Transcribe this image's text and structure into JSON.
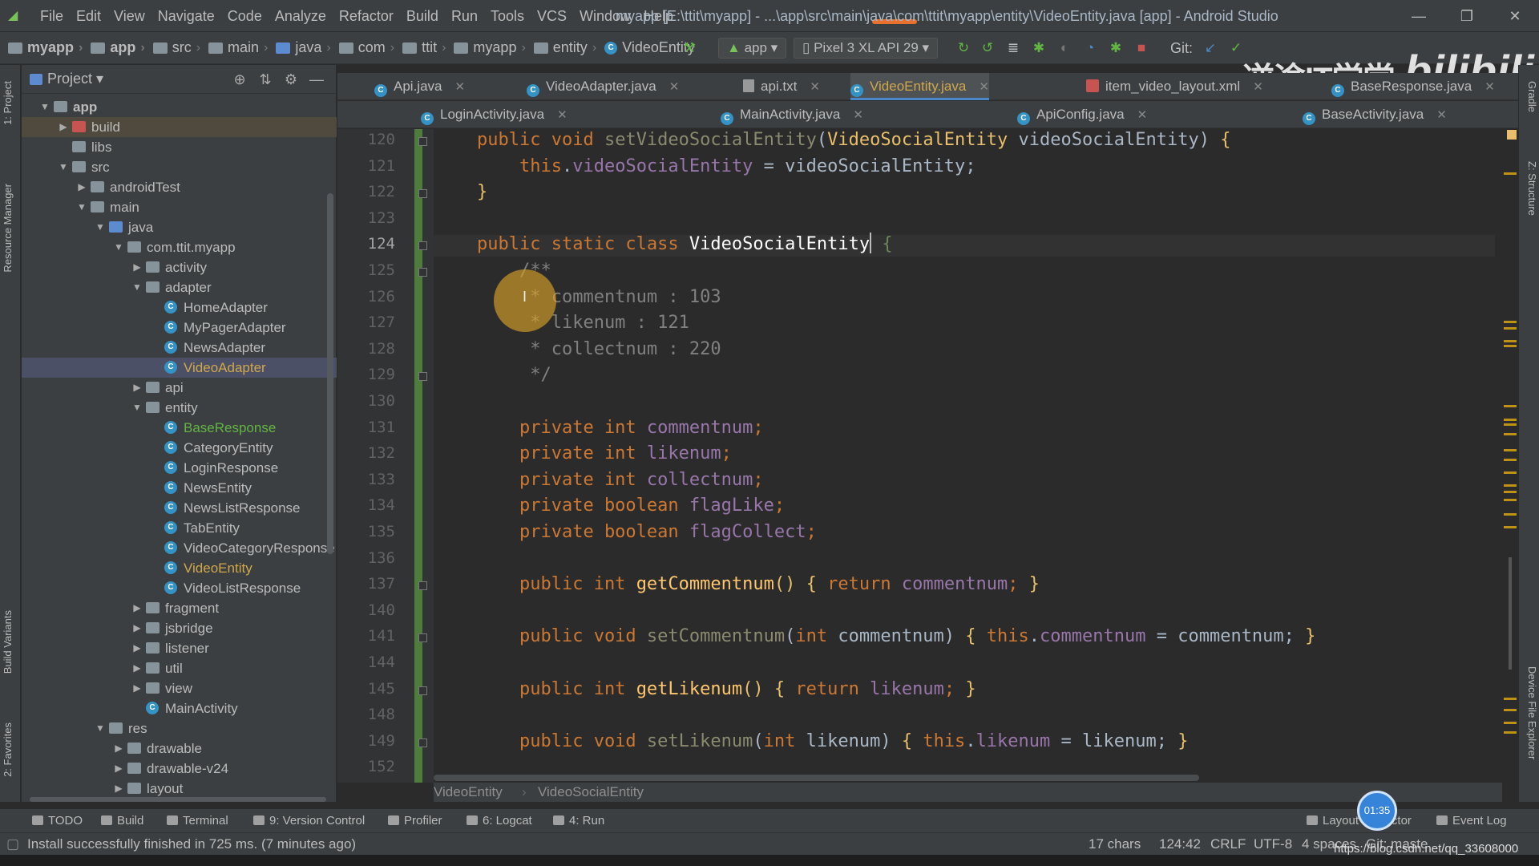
{
  "window": {
    "menu": [
      "File",
      "Edit",
      "View",
      "Navigate",
      "Code",
      "Analyze",
      "Refactor",
      "Build",
      "Run",
      "Tools",
      "VCS",
      "Window",
      "Help"
    ],
    "title": "myapp [E:\\ttit\\myapp] - ...\\app\\src\\main\\java\\com\\ttit\\myapp\\entity\\VideoEntity.java [app] - Android Studio",
    "controls": [
      "—",
      "❐",
      "✕"
    ]
  },
  "nav": {
    "crumbs": [
      "myapp",
      "app",
      "src",
      "main",
      "java",
      "com",
      "ttit",
      "myapp",
      "entity",
      "VideoEntity"
    ],
    "run_config": "app",
    "device": "Pixel 3 XL API 29",
    "git_label": "Git:"
  },
  "project": {
    "title": "Project",
    "tree": [
      {
        "label": "app",
        "depth": 0,
        "arrow": "▼",
        "icon": "folder",
        "style": "bold"
      },
      {
        "label": "build",
        "depth": 1,
        "arrow": "▶",
        "icon": "folder-red",
        "style": "hl"
      },
      {
        "label": "libs",
        "depth": 1,
        "arrow": "",
        "icon": "folder"
      },
      {
        "label": "src",
        "depth": 1,
        "arrow": "▼",
        "icon": "folder"
      },
      {
        "label": "androidTest",
        "depth": 2,
        "arrow": "▶",
        "icon": "folder"
      },
      {
        "label": "main",
        "depth": 2,
        "arrow": "▼",
        "icon": "folder"
      },
      {
        "label": "java",
        "depth": 3,
        "arrow": "▼",
        "icon": "folder-blue"
      },
      {
        "label": "com.ttit.myapp",
        "depth": 4,
        "arrow": "▼",
        "icon": "folder"
      },
      {
        "label": "activity",
        "depth": 5,
        "arrow": "▶",
        "icon": "folder"
      },
      {
        "label": "adapter",
        "depth": 5,
        "arrow": "▼",
        "icon": "folder"
      },
      {
        "label": "HomeAdapter",
        "depth": 6,
        "arrow": "",
        "icon": "class"
      },
      {
        "label": "MyPagerAdapter",
        "depth": 6,
        "arrow": "",
        "icon": "class"
      },
      {
        "label": "NewsAdapter",
        "depth": 6,
        "arrow": "",
        "icon": "class"
      },
      {
        "label": "VideoAdapter",
        "depth": 6,
        "arrow": "",
        "icon": "class",
        "style": "sel-blue"
      },
      {
        "label": "api",
        "depth": 5,
        "arrow": "▶",
        "icon": "folder"
      },
      {
        "label": "entity",
        "depth": 5,
        "arrow": "▼",
        "icon": "folder"
      },
      {
        "label": "BaseResponse",
        "depth": 6,
        "arrow": "",
        "icon": "class",
        "style": "green"
      },
      {
        "label": "CategoryEntity",
        "depth": 6,
        "arrow": "",
        "icon": "class"
      },
      {
        "label": "LoginResponse",
        "depth": 6,
        "arrow": "",
        "icon": "class"
      },
      {
        "label": "NewsEntity",
        "depth": 6,
        "arrow": "",
        "icon": "class"
      },
      {
        "label": "NewsListResponse",
        "depth": 6,
        "arrow": "",
        "icon": "class"
      },
      {
        "label": "TabEntity",
        "depth": 6,
        "arrow": "",
        "icon": "class"
      },
      {
        "label": "VideoCategoryResponse",
        "depth": 6,
        "arrow": "",
        "icon": "class"
      },
      {
        "label": "VideoEntity",
        "depth": 6,
        "arrow": "",
        "icon": "class",
        "style": "blue"
      },
      {
        "label": "VideoListResponse",
        "depth": 6,
        "arrow": "",
        "icon": "class"
      },
      {
        "label": "fragment",
        "depth": 5,
        "arrow": "▶",
        "icon": "folder"
      },
      {
        "label": "jsbridge",
        "depth": 5,
        "arrow": "▶",
        "icon": "folder"
      },
      {
        "label": "listener",
        "depth": 5,
        "arrow": "▶",
        "icon": "folder"
      },
      {
        "label": "util",
        "depth": 5,
        "arrow": "▶",
        "icon": "folder"
      },
      {
        "label": "view",
        "depth": 5,
        "arrow": "▶",
        "icon": "folder"
      },
      {
        "label": "MainActivity",
        "depth": 5,
        "arrow": "",
        "icon": "class"
      },
      {
        "label": "res",
        "depth": 3,
        "arrow": "▼",
        "icon": "folder"
      },
      {
        "label": "drawable",
        "depth": 4,
        "arrow": "▶",
        "icon": "folder"
      },
      {
        "label": "drawable-v24",
        "depth": 4,
        "arrow": "▶",
        "icon": "folder"
      },
      {
        "label": "layout",
        "depth": 4,
        "arrow": "▶",
        "icon": "folder"
      }
    ]
  },
  "tabs_row1": [
    {
      "label": "Api.java",
      "kind": "class"
    },
    {
      "label": "VideoAdapter.java",
      "kind": "class"
    },
    {
      "label": "api.txt",
      "kind": "txt"
    },
    {
      "label": "VideoEntity.java",
      "kind": "class",
      "active": true
    },
    {
      "label": "item_video_layout.xml",
      "kind": "xml"
    },
    {
      "label": "BaseResponse.java",
      "kind": "class"
    }
  ],
  "tabs_row2": [
    {
      "label": "LoginActivity.java",
      "kind": "class"
    },
    {
      "label": "MainActivity.java",
      "kind": "class"
    },
    {
      "label": "ApiConfig.java",
      "kind": "class"
    },
    {
      "label": "BaseActivity.java",
      "kind": "class"
    }
  ],
  "editor": {
    "line_numbers": [
      "120",
      "121",
      "122",
      "123",
      "124",
      "125",
      "126",
      "127",
      "128",
      "129",
      "130",
      "131",
      "132",
      "133",
      "134",
      "135",
      "136",
      "137",
      "140",
      "141",
      "144",
      "145",
      "148",
      "149",
      "152"
    ],
    "current_line": "124",
    "lines": [
      [
        [
          "kw",
          "public void "
        ],
        [
          "mth2",
          "setVideoSocialEntity"
        ],
        [
          "p",
          "("
        ],
        [
          "typhl",
          "VideoSocialEntity"
        ],
        [
          "p",
          " videoSocialEntity) "
        ],
        [
          "by",
          "{"
        ]
      ],
      [
        [
          "p",
          "    "
        ],
        [
          "kw",
          "this"
        ],
        [
          "p",
          "."
        ],
        [
          "fld",
          "videoSocialEntity"
        ],
        [
          "p",
          " = videoSocialEntity;"
        ]
      ],
      [
        [
          "by",
          "}"
        ]
      ],
      [],
      [
        [
          "kw",
          "public static class "
        ],
        [
          "cur",
          "VideoSocialEntity"
        ],
        [
          "caret",
          ""
        ],
        [
          "p",
          " "
        ],
        [
          "bg",
          "{"
        ]
      ],
      [
        [
          "cm",
          "    /**"
        ]
      ],
      [
        [
          "cm",
          "     * commentnum : 103"
        ]
      ],
      [
        [
          "cm",
          "     * likenum : 121"
        ]
      ],
      [
        [
          "cm",
          "     * collectnum : 220"
        ]
      ],
      [
        [
          "cm",
          "     */"
        ]
      ],
      [],
      [
        [
          "kw",
          "    private int "
        ],
        [
          "fld",
          "commentnum"
        ],
        [
          "kw",
          ";"
        ]
      ],
      [
        [
          "kw",
          "    private int "
        ],
        [
          "fld",
          "likenum"
        ],
        [
          "kw",
          ";"
        ]
      ],
      [
        [
          "kw",
          "    private int "
        ],
        [
          "fld",
          "collectnum"
        ],
        [
          "kw",
          ";"
        ]
      ],
      [
        [
          "kw",
          "    private boolean "
        ],
        [
          "fld",
          "flagLike"
        ],
        [
          "kw",
          ";"
        ]
      ],
      [
        [
          "kw",
          "    private boolean "
        ],
        [
          "fld",
          "flagCollect"
        ],
        [
          "kw",
          ";"
        ]
      ],
      [],
      [
        [
          "kw",
          "    public int "
        ],
        [
          "mth",
          "getCommentnum"
        ],
        [
          "by",
          "()"
        ],
        [
          "p",
          " "
        ],
        [
          "by",
          "{"
        ],
        [
          "kw",
          " return "
        ],
        [
          "fld",
          "commentnum"
        ],
        [
          "kw",
          "; "
        ],
        [
          "by",
          "}"
        ]
      ],
      [],
      [
        [
          "kw",
          "    public void "
        ],
        [
          "mth2",
          "setCommentnum"
        ],
        [
          "p",
          "("
        ],
        [
          "kw",
          "int "
        ],
        [
          "p",
          "commentnum) "
        ],
        [
          "by",
          "{"
        ],
        [
          "kw",
          " this"
        ],
        [
          "p",
          "."
        ],
        [
          "fld",
          "commentnum"
        ],
        [
          "p",
          " = commentnum; "
        ],
        [
          "by",
          "}"
        ]
      ],
      [],
      [
        [
          "kw",
          "    public int "
        ],
        [
          "mth",
          "getLikenum"
        ],
        [
          "by",
          "()"
        ],
        [
          "p",
          " "
        ],
        [
          "by",
          "{"
        ],
        [
          "kw",
          " return "
        ],
        [
          "fld",
          "likenum"
        ],
        [
          "kw",
          "; "
        ],
        [
          "by",
          "}"
        ]
      ],
      [],
      [
        [
          "kw",
          "    public void "
        ],
        [
          "mth2",
          "setLikenum"
        ],
        [
          "p",
          "("
        ],
        [
          "kw",
          "int "
        ],
        [
          "p",
          "likenum) "
        ],
        [
          "by",
          "{"
        ],
        [
          "kw",
          " this"
        ],
        [
          "p",
          "."
        ],
        [
          "fld",
          "likenum"
        ],
        [
          "p",
          " = likenum; "
        ],
        [
          "by",
          "}"
        ]
      ],
      []
    ],
    "breadcrumb": [
      "VideoEntity",
      "VideoSocialEntity"
    ]
  },
  "left_tabs": [
    "1: Project",
    "Resource Manager",
    "Build Variants",
    "2: Favorites"
  ],
  "right_tabs": [
    "Gradle",
    "Z: Structure",
    "Device File Explorer"
  ],
  "bottom_tools": [
    "TODO",
    "Build",
    "Terminal",
    "9: Version Control",
    "Profiler",
    "6: Logcat",
    "4: Run",
    "Layout Inspector",
    "Event Log"
  ],
  "status": {
    "message": "Install successfully finished in 725 ms. (7 minutes ago)",
    "chars": "17 chars",
    "position": "124:42",
    "line_sep": "CRLF",
    "encoding": "UTF-8",
    "indent": "4 spaces",
    "git": "Git: maste"
  },
  "overlays": {
    "timer": "01:35",
    "watermark_cn": "逆途IT学堂",
    "watermark_bili": "bilibili",
    "url": "https://blog.csdn.net/qq_33608000"
  },
  "colors": {
    "keyword": "#cc7832",
    "field": "#9876aa",
    "method": "#ffc66d",
    "comment": "#808080",
    "background": "#2b2b2b",
    "panel": "#3c3f41"
  }
}
